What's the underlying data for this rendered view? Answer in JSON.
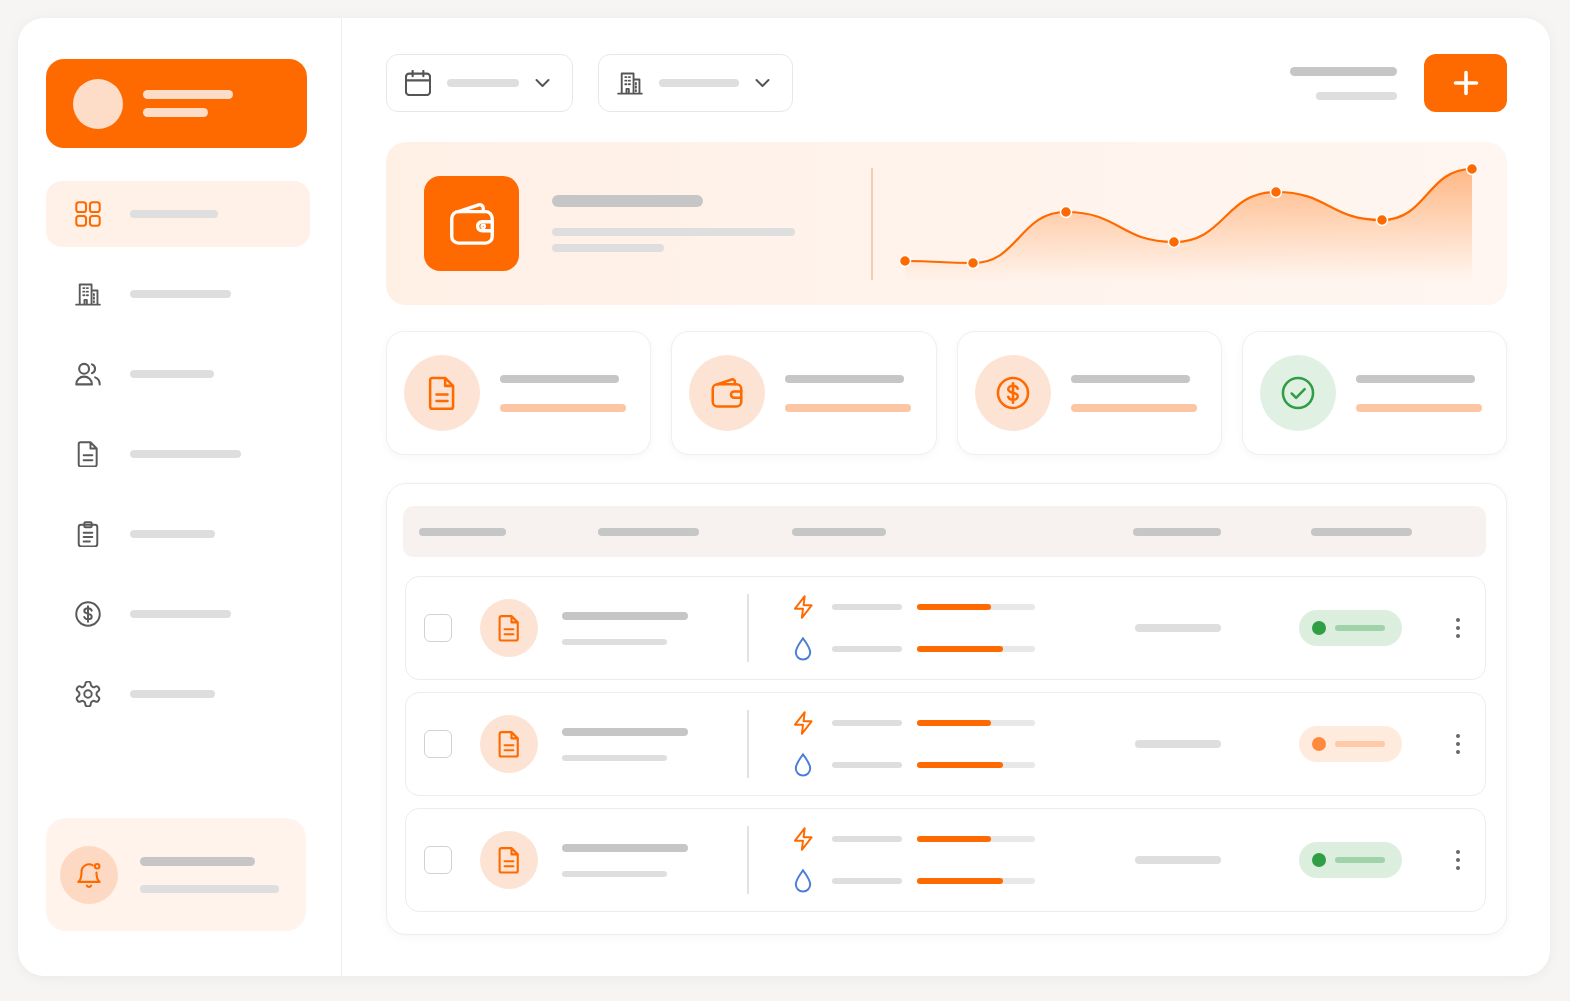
{
  "sidebar": {
    "items": [
      {
        "selected": true
      },
      {
        "selected": false
      },
      {
        "selected": false
      },
      {
        "selected": false
      },
      {
        "selected": false
      },
      {
        "selected": false
      },
      {
        "selected": false
      }
    ]
  },
  "table": {
    "rows": [
      {
        "checked": false,
        "metrics": [
          {
            "kind": "energy",
            "level": 0.63
          },
          {
            "kind": "water",
            "level": 0.73
          }
        ],
        "color": "#2f9e44"
      },
      {
        "checked": false,
        "metrics": [
          {
            "kind": "energy",
            "level": 0.63
          },
          {
            "kind": "water",
            "level": 0.73
          }
        ],
        "color": "#ff8a3d"
      },
      {
        "checked": false,
        "metrics": [
          {
            "kind": "energy",
            "level": 0.63
          },
          {
            "kind": "water",
            "level": 0.73
          }
        ],
        "color": "#2f9e44"
      }
    ]
  }
}
